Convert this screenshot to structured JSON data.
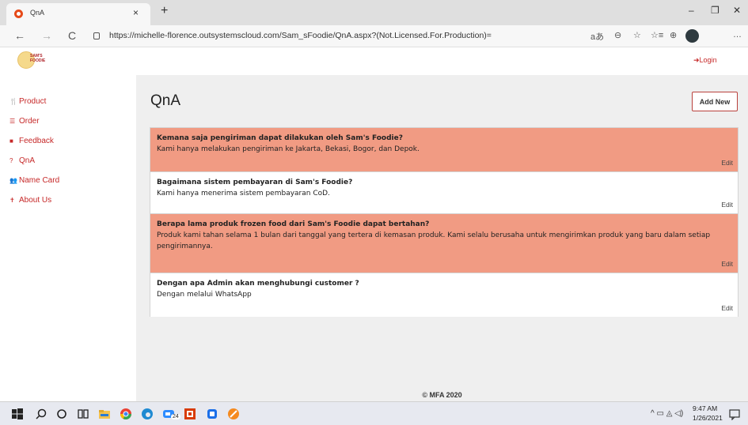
{
  "browser": {
    "tab_title": "QnA",
    "tab_close": "×",
    "new_tab": "+",
    "minimize": "–",
    "restore": "❐",
    "close": "✕",
    "back": "←",
    "forward": "→",
    "refresh": "C",
    "url": "https://michelle-florence.outsystemscloud.com/Sam_sFoodie/QnA.aspx?(Not.Licensed.For.Production)=",
    "tools": [
      "aあ",
      "⊖",
      "☆",
      "☆≡",
      "⊕",
      "…"
    ]
  },
  "header": {
    "logo_text_line1": "SAM'S",
    "logo_text_line2": "FOODIE",
    "login_label": "Login"
  },
  "sidebar": {
    "items": [
      {
        "label": "Product",
        "icon": "utensils-icon",
        "glyph": "🍴"
      },
      {
        "label": "Order",
        "icon": "list-icon",
        "glyph": "☰"
      },
      {
        "label": "Feedback",
        "icon": "feedback-icon",
        "glyph": "■"
      },
      {
        "label": "QnA",
        "icon": "question-icon",
        "glyph": "?"
      },
      {
        "label": "Name Card",
        "icon": "users-icon",
        "glyph": "👥"
      },
      {
        "label": "About Us",
        "icon": "info-icon",
        "glyph": "✝"
      }
    ]
  },
  "main": {
    "title": "QnA",
    "add_new_label": "Add New",
    "edit_label": "Edit",
    "items": [
      {
        "question": "Kemana saja pengiriman dapat dilakukan oleh Sam's Foodie?",
        "answer": "Kami hanya melakukan pengiriman ke Jakarta, Bekasi, Bogor, dan Depok."
      },
      {
        "question": "Bagaimana sistem pembayaran di Sam's Foodie?",
        "answer": "Kami hanya menerima sistem pembayaran CoD."
      },
      {
        "question": "Berapa lama produk frozen food dari Sam's Foodie dapat bertahan?",
        "answer": "Produk kami tahan selama 1 bulan dari tanggal yang tertera di kemasan produk. Kami selalu berusaha untuk mengirimkan produk yang baru dalam setiap pengirimannya."
      },
      {
        "question": "Dengan apa Admin akan menghubungi customer ?",
        "answer": "Dengan melalui WhatsApp"
      }
    ],
    "footer": "© MFA 2020"
  },
  "taskbar": {
    "time": "9:47 AM",
    "date": "1/26/2021",
    "badge": "24",
    "tray": "^ ▭ ◬ ◁)"
  },
  "colors": {
    "accent": "#c62828",
    "highlight_row": "#f19b83",
    "content_bg": "#efefef"
  }
}
